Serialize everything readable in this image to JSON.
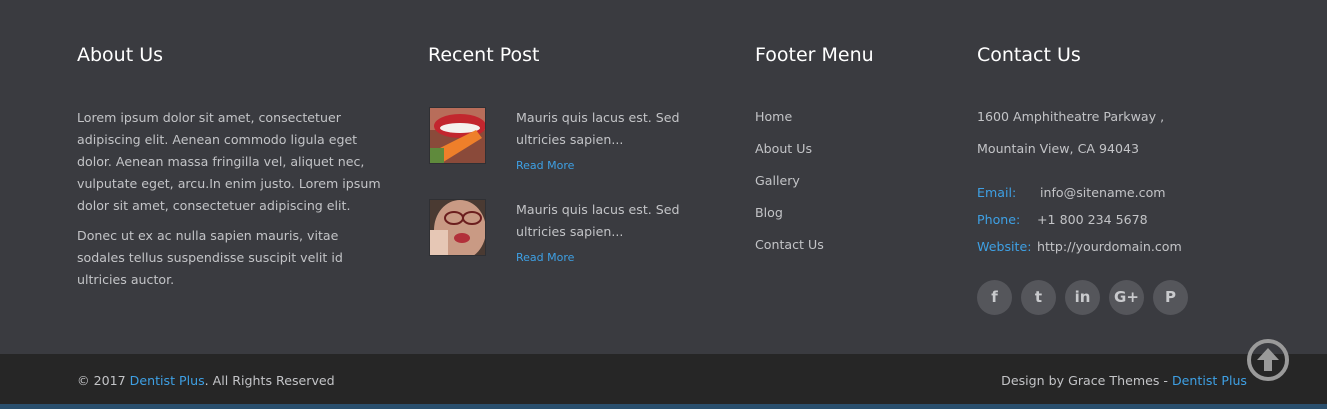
{
  "about": {
    "title": "About Us",
    "paragraph1": "Lorem ipsum dolor sit amet, consectetuer adipiscing elit. Aenean commodo ligula eget dolor. Aenean massa fringilla vel, aliquet nec, vulputate eget, arcu.In enim justo. Lorem ipsum dolor sit amet, consectetuer adipiscing elit.",
    "paragraph2": "Donec ut ex ac nulla sapien mauris, vitae sodales tellus suspendisse suscipit velit id ultricies auctor."
  },
  "recent": {
    "title": "Recent Post",
    "posts": [
      {
        "excerpt": "Mauris quis lacus est. Sed ultricies sapien...",
        "read_more": "Read More"
      },
      {
        "excerpt": "Mauris quis lacus est. Sed ultricies sapien...",
        "read_more": "Read More"
      }
    ]
  },
  "menu": {
    "title": "Footer Menu",
    "items": [
      "Home",
      "About Us",
      "Gallery",
      "Blog",
      "Contact Us"
    ]
  },
  "contact": {
    "title": "Contact Us",
    "address_line1": "1600 Amphitheatre Parkway ,",
    "address_line2": "Mountain View, CA 94043",
    "email_label": "Email:",
    "email": "info@sitename.com",
    "phone_label": "Phone:",
    "phone": "+1 800 234 5678",
    "website_label": "Website:",
    "website": "http://yourdomain.com",
    "socials": [
      {
        "icon": "facebook-icon",
        "glyph": "f"
      },
      {
        "icon": "twitter-icon",
        "glyph": "t"
      },
      {
        "icon": "linkedin-icon",
        "glyph": "in"
      },
      {
        "icon": "google-plus-icon",
        "glyph": "G+"
      },
      {
        "icon": "pinterest-icon",
        "glyph": "P"
      }
    ]
  },
  "bottom": {
    "copyright_prefix": "© 2017 ",
    "copyright_brand": "Dentist Plus",
    "copyright_suffix": ". All Rights Reserved",
    "credit_prefix": "Design by Grace Themes - ",
    "credit_brand": "Dentist Plus"
  },
  "colors": {
    "background": "#3a3b40",
    "bottom_bar": "#262626",
    "accent": "#3ea0e4",
    "heading": "#ffffff",
    "text": "#c3c4c7"
  }
}
